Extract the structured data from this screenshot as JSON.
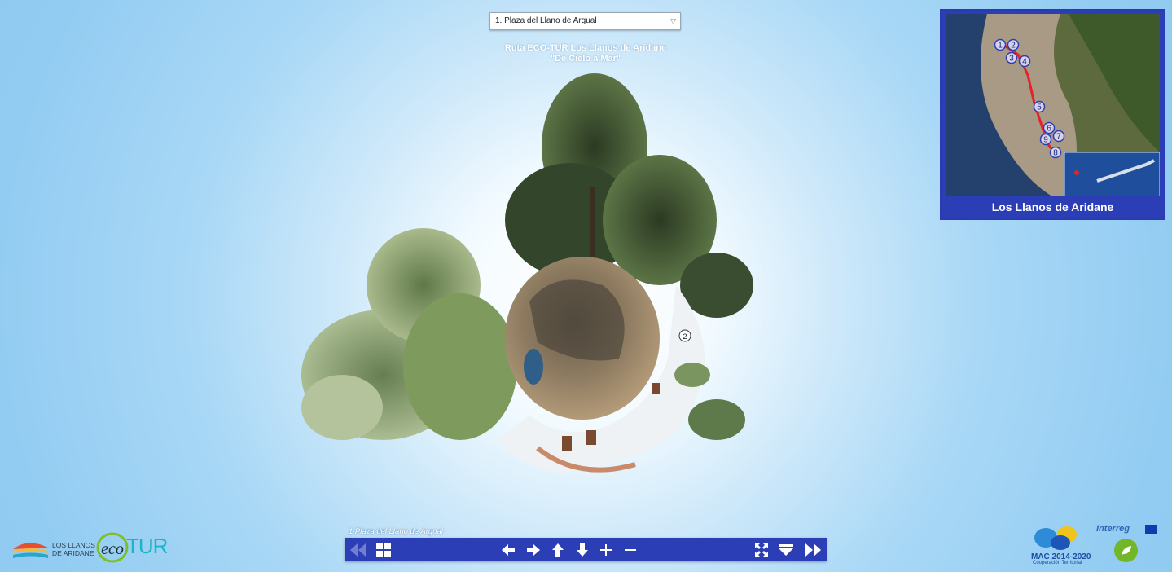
{
  "scene_select": {
    "value": "1. Plaza del Llano de Argual"
  },
  "tour_title": {
    "line1": "Ruta ECO-TUR Los Llanos de Aridane",
    "line2": "\"De Cielo a Mar\""
  },
  "map": {
    "title": "Los Llanos de Aridane",
    "markers": [
      "1",
      "2",
      "3",
      "4",
      "5",
      "6",
      "7",
      "8",
      "9"
    ],
    "route_color": "#e0242a"
  },
  "scene_caption": "1 Plaza del Llano de Argual",
  "toolbar": {
    "color": "#2c3eb5",
    "buttons": [
      "previous-scene",
      "thumbnails",
      "pan-left",
      "pan-right",
      "pan-up",
      "pan-down",
      "zoom-in",
      "zoom-out",
      "fullscreen",
      "hide-controls",
      "next-scene"
    ]
  },
  "hotspot_label": "2",
  "logos": {
    "llanos_line1": "LOS LLANOS",
    "llanos_line2": "DE ARIDANE",
    "eco": "eco",
    "tur": "TUR",
    "mac": "MAC 2014-2020",
    "mac_sub": "Cooperación Territorial",
    "interreg": "Interreg"
  }
}
